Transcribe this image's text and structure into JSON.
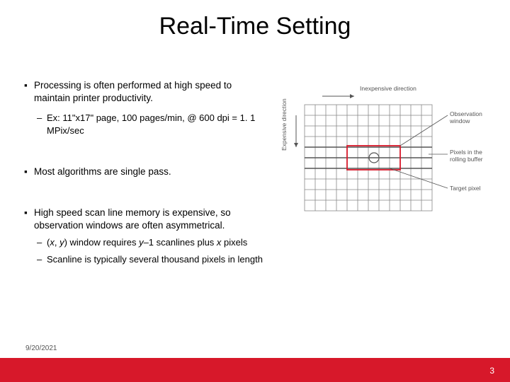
{
  "title": "Real-Time Setting",
  "bullets": {
    "b1": "Processing is often performed at high speed to maintain printer productivity.",
    "b1a": "Ex: 11\"x17\" page, 100 pages/min, @ 600 dpi = 1. 1 MPix/sec",
    "b2": "Most algorithms are single pass.",
    "b3": "High speed scan line memory is expensive, so observation windows are often asymmetrical.",
    "b3a_pre": "(",
    "b3a_x": "x",
    "b3a_mid1": ", ",
    "b3a_y": "y",
    "b3a_mid2": ") window requires ",
    "b3a_y2": "y",
    "b3a_mid3": "–1 scanlines plus ",
    "b3a_x2": "x",
    "b3a_post": " pixels",
    "b3b": "Scanline is typically several thousand pixels in length"
  },
  "figure": {
    "label_top": "Inexpensive direction",
    "label_left": "Expensive direction",
    "label_right_top": "Observation window",
    "label_right_mid": "Pixels in the rolling buffer",
    "label_right_bot": "Target pixel"
  },
  "footer": {
    "date": "9/20/2021",
    "page": "3"
  },
  "colors": {
    "accent": "#d7182a"
  }
}
